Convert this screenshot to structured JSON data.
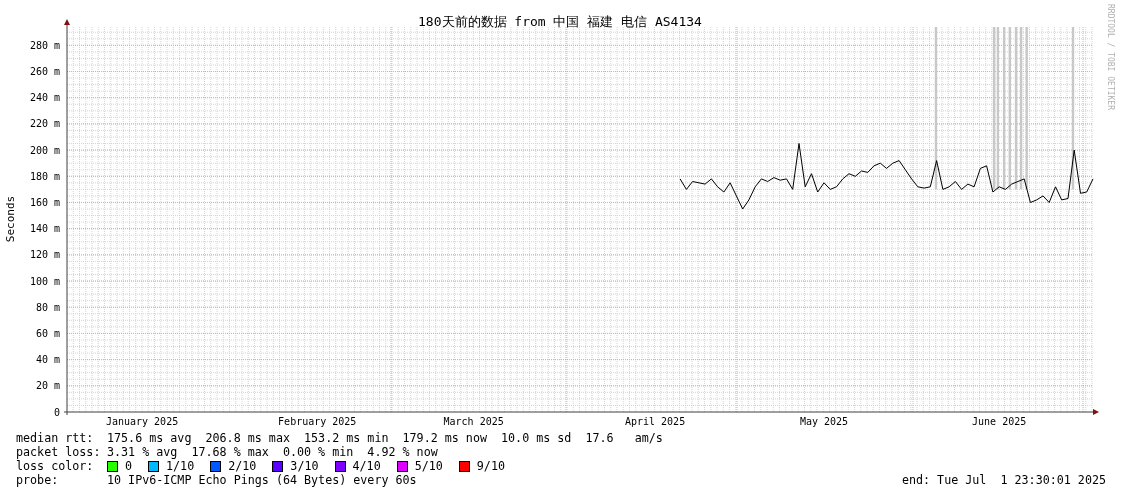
{
  "chart": {
    "chart_data": {
      "type": "line",
      "title": "180天前的数据 from 中国 福建 电信 AS4134",
      "ylabel": "Seconds",
      "ylim": [
        0,
        294
      ],
      "categories": [
        null,
        null,
        null,
        null,
        null,
        null,
        null,
        null,
        null,
        null,
        null,
        null,
        "January 2025",
        null,
        null,
        null,
        null,
        null,
        null,
        null,
        null,
        null,
        null,
        null,
        null,
        null,
        null,
        null,
        null,
        null,
        null,
        null,
        null,
        null,
        null,
        null,
        null,
        null,
        null,
        null,
        "February 2025",
        null,
        null,
        null,
        null,
        null,
        null,
        null,
        null,
        null,
        null,
        null,
        null,
        null,
        null,
        null,
        null,
        null,
        null,
        null,
        null,
        null,
        null,
        null,
        null,
        "March 2025",
        null,
        null,
        null,
        null,
        null,
        null,
        null,
        null,
        null,
        null,
        null,
        null,
        null,
        null,
        null,
        null,
        null,
        null,
        null,
        null,
        null,
        null,
        null,
        null,
        null,
        null,
        null,
        null,
        "April 2025",
        null,
        null,
        null,
        null,
        null,
        null,
        null,
        null,
        null,
        null,
        null,
        null,
        null,
        null,
        null,
        null,
        null,
        null,
        null,
        null,
        null,
        null,
        null,
        null,
        null,
        null,
        "May 2025",
        null,
        null,
        null,
        null,
        null,
        null,
        null,
        null,
        null,
        null,
        null,
        null,
        null,
        null,
        null,
        null,
        null,
        null,
        null,
        null,
        null,
        null,
        null,
        null,
        null,
        null,
        null,
        "June 2025",
        null,
        null,
        null,
        null,
        null,
        null,
        null,
        null,
        null,
        null,
        null,
        null,
        null,
        null,
        null
      ],
      "yticks": [
        {
          "value": 0,
          "label": "0"
        },
        {
          "value": 20,
          "label": "20 m"
        },
        {
          "value": 40,
          "label": "40 m"
        },
        {
          "value": 60,
          "label": "60 m"
        },
        {
          "value": 80,
          "label": "80 m"
        },
        {
          "value": 100,
          "label": "100 m"
        },
        {
          "value": 120,
          "label": "120 m"
        },
        {
          "value": 140,
          "label": "140 m"
        },
        {
          "value": 160,
          "label": "160 m"
        },
        {
          "value": 180,
          "label": "180 m"
        },
        {
          "value": 200,
          "label": "200 m"
        },
        {
          "value": 220,
          "label": "220 m"
        },
        {
          "value": 240,
          "label": "240 m"
        },
        {
          "value": 260,
          "label": "260 m"
        },
        {
          "value": 280,
          "label": "280 m"
        }
      ],
      "series": [
        {
          "color": "#000000",
          "values": [
            null,
            null,
            null,
            null,
            null,
            null,
            null,
            null,
            null,
            null,
            null,
            null,
            null,
            null,
            null,
            null,
            null,
            null,
            null,
            null,
            null,
            null,
            null,
            null,
            null,
            null,
            null,
            null,
            null,
            null,
            null,
            null,
            null,
            null,
            null,
            null,
            null,
            null,
            null,
            null,
            null,
            null,
            null,
            null,
            null,
            null,
            null,
            null,
            null,
            null,
            null,
            null,
            null,
            null,
            null,
            null,
            null,
            null,
            null,
            null,
            null,
            null,
            null,
            null,
            null,
            null,
            null,
            null,
            null,
            null,
            null,
            null,
            null,
            null,
            null,
            null,
            null,
            null,
            null,
            null,
            null,
            null,
            null,
            null,
            null,
            null,
            null,
            null,
            null,
            null,
            null,
            null,
            null,
            null,
            null,
            null,
            null,
            null,
            178,
            170,
            176,
            175,
            174,
            178,
            172,
            168,
            175,
            165,
            155,
            162,
            172,
            178,
            176,
            179,
            177,
            178,
            170,
            205,
            172,
            182,
            168,
            175,
            170,
            172,
            178,
            182,
            180,
            184,
            183,
            188,
            190,
            186,
            190,
            192,
            185,
            178,
            172,
            171,
            172,
            192,
            170,
            172,
            176,
            170,
            174,
            172,
            186,
            188,
            168,
            172,
            170,
            174,
            176,
            178,
            160,
            162,
            165,
            160,
            172,
            162,
            163,
            200,
            167,
            168,
            178
          ]
        }
      ],
      "grid": true
    },
    "credit": "RRDTOOL / TOBI OETIKER"
  },
  "legend": [
    {
      "kind": "stats",
      "label": "median rtt:",
      "text": "175.6 ms avg  206.8 ms max  153.2 ms min  179.2 ms now  10.0 ms sd  17.6   am/s"
    },
    {
      "kind": "stats",
      "label": "packet loss:",
      "text": "3.31 % avg  17.68 % max  0.00 % min  4.92 % now"
    },
    {
      "kind": "swatches",
      "label": "loss color:",
      "items": [
        {
          "label": "0",
          "color": "#26ff00"
        },
        {
          "label": "1/10",
          "color": "#00b8ff"
        },
        {
          "label": "2/10",
          "color": "#0059ff"
        },
        {
          "label": "3/10",
          "color": "#5e00ff"
        },
        {
          "label": "4/10",
          "color": "#7e00ff"
        },
        {
          "label": "5/10",
          "color": "#dd00ff"
        },
        {
          "label": "9/10",
          "color": "#ff0000"
        }
      ]
    },
    {
      "kind": "probe",
      "label": "probe:",
      "text": "10 IPv6-ICMP Echo Pings (64 Bytes) every 60s",
      "end": "end: Tue Jul  1 23:30:01 2025"
    }
  ]
}
